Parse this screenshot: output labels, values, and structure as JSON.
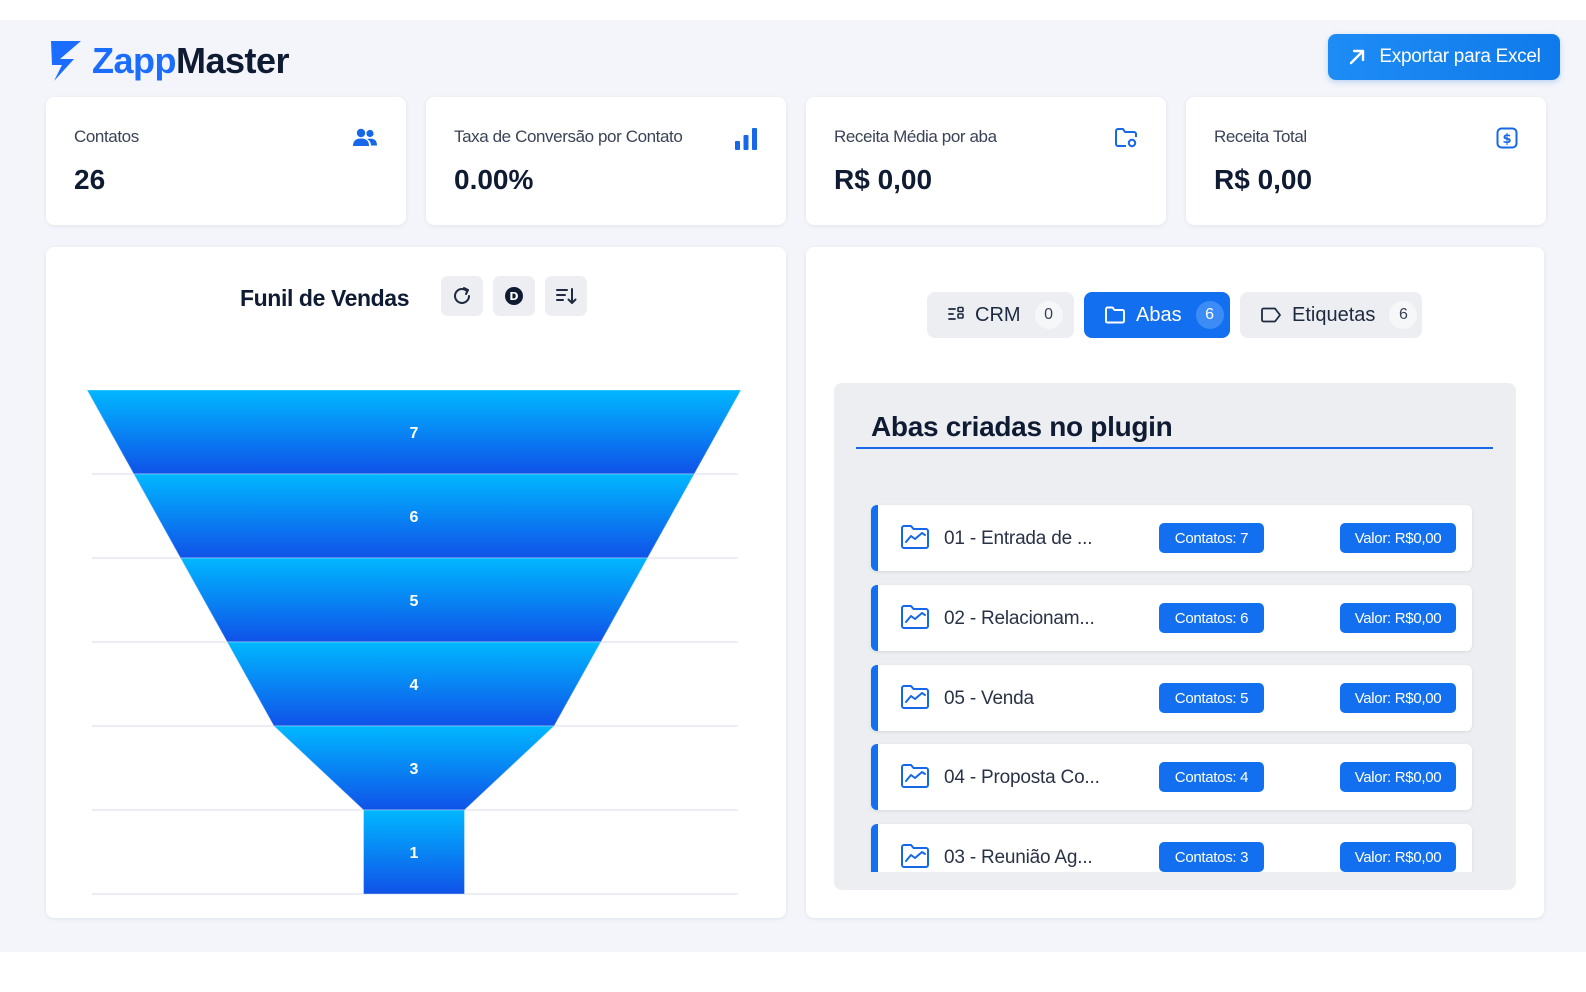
{
  "header": {
    "logo_part1": "Zapp",
    "logo_part2": "Master",
    "export_label": "Exportar para Excel"
  },
  "kpis": [
    {
      "label": "Contatos",
      "value": "26",
      "icon": "users-icon"
    },
    {
      "label": "Taxa de Conversão por Contato",
      "value": "0.00%",
      "icon": "bar-chart-icon"
    },
    {
      "label": "Receita Média por aba",
      "value": "R$ 0,00",
      "icon": "folder-settings-icon"
    },
    {
      "label": "Receita Total",
      "value": "R$ 0,00",
      "icon": "dollar-icon"
    }
  ],
  "funnel": {
    "title": "Funil de Vendas",
    "tools": [
      "refresh-icon",
      "d-icon",
      "sort-icon"
    ]
  },
  "chart_data": {
    "type": "funnel",
    "title": "Funil de Vendas",
    "values": [
      7,
      6,
      5,
      4,
      3,
      1
    ],
    "labels": [
      "7",
      "6",
      "5",
      "4",
      "3",
      "1"
    ],
    "grid": true
  },
  "tabs": [
    {
      "label": "CRM",
      "count": "0",
      "active": false
    },
    {
      "label": "Abas",
      "count": "6",
      "active": true
    },
    {
      "label": "Etiquetas",
      "count": "6",
      "active": false
    }
  ],
  "list": {
    "title": "Abas criadas no plugin",
    "items": [
      {
        "name": "01 - Entrada de ...",
        "contatos": "Contatos: 7",
        "valor": "Valor: R$0,00"
      },
      {
        "name": "02 - Relacionam...",
        "contatos": "Contatos: 6",
        "valor": "Valor: R$0,00"
      },
      {
        "name": "05 - Venda",
        "contatos": "Contatos: 5",
        "valor": "Valor: R$0,00"
      },
      {
        "name": "04 - Proposta Co...",
        "contatos": "Contatos: 4",
        "valor": "Valor: R$0,00"
      },
      {
        "name": "03 - Reunião Ag...",
        "contatos": "Contatos: 3",
        "valor": "Valor: R$0,00"
      }
    ]
  },
  "colors": {
    "accent": "#1270f0",
    "funnel_top": "#00b7ff",
    "funnel_bottom": "#1052e8"
  }
}
